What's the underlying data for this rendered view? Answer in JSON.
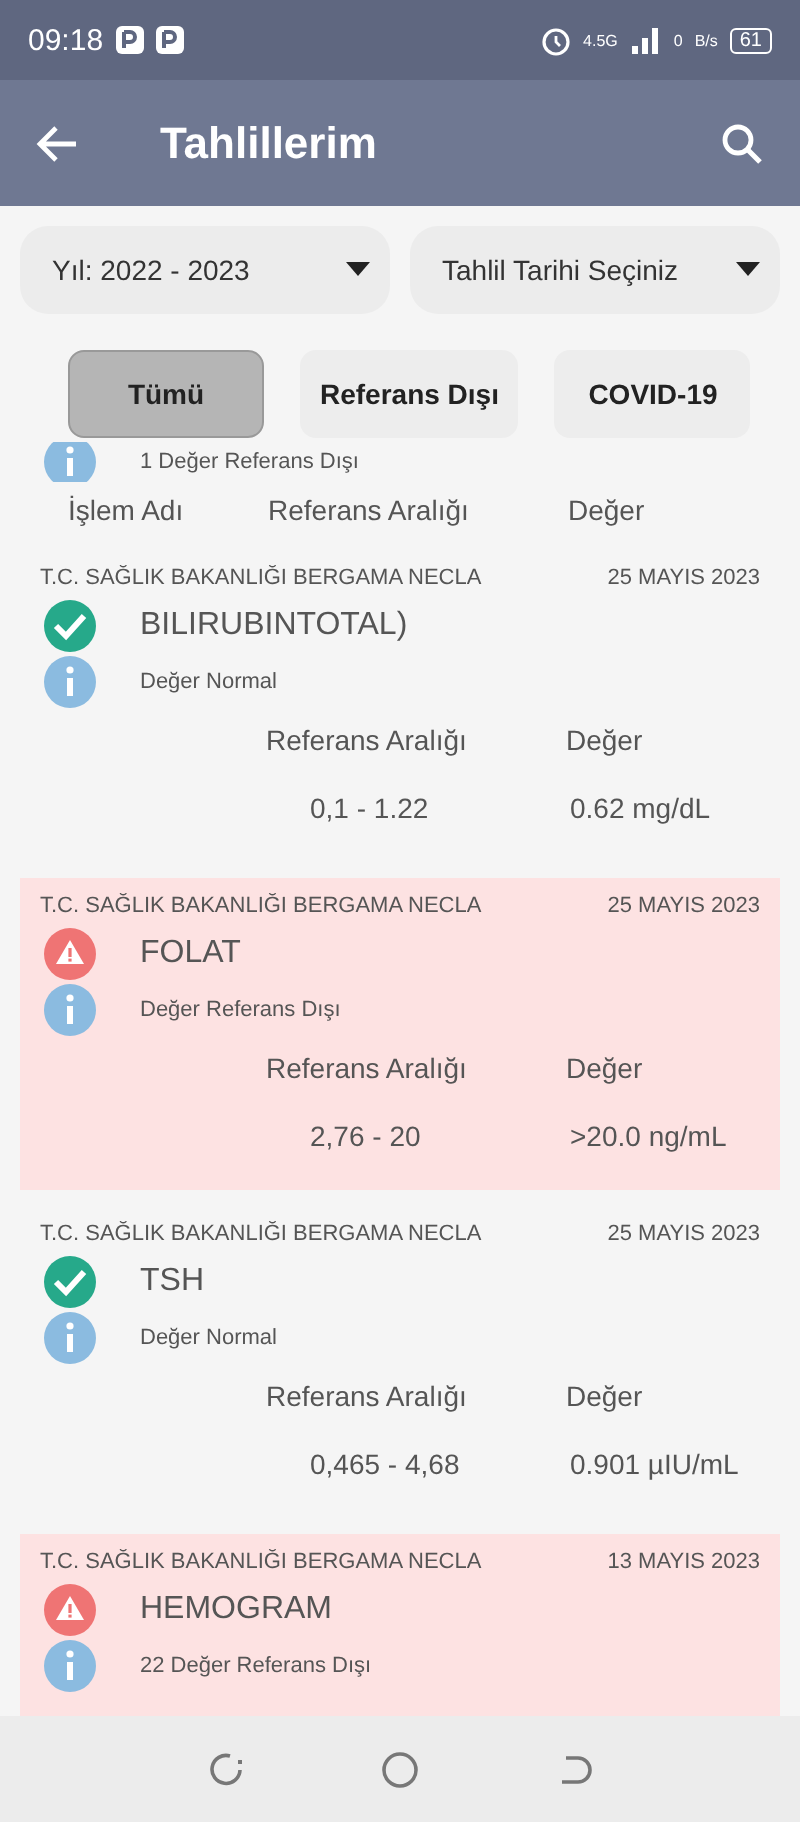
{
  "status_bar": {
    "time": "09:18",
    "battery": "61",
    "net_speed_value": "0",
    "net_speed_unit": "B/s",
    "network": "4.5G"
  },
  "app_bar": {
    "title": "Tahlillerim"
  },
  "filters": [
    {
      "label": "Yıl: 2022 - 2023"
    },
    {
      "label": "Tahlil Tarihi Seçiniz"
    }
  ],
  "tabs": [
    {
      "label": "Tümü",
      "selected": true
    },
    {
      "label": "Referans Dışı",
      "selected": false
    },
    {
      "label": "COVID-19",
      "selected": false
    }
  ],
  "partial_item": {
    "status_text": "1 Değer Referans Dışı"
  },
  "columns": [
    "İşlem Adı",
    "Referans Aralığı",
    "Değer"
  ],
  "results": [
    {
      "source": "T.C. SAĞLIK BAKANLIĞI BERGAMA NECLA",
      "date": "25 MAYIS 2023",
      "name": "BILIRUBINTOTAL)",
      "kind": "normal",
      "status_text": "Değer Normal",
      "range_label": "Referans Aralığı",
      "value_label": "Değer",
      "range": "0,1 - 1.22",
      "value": "0.62 mg/dL"
    },
    {
      "source": "T.C. SAĞLIK BAKANLIĞI BERGAMA NECLA",
      "date": "25 MAYIS 2023",
      "name": "FOLAT",
      "kind": "out",
      "status_text": "Değer Referans Dışı",
      "range_label": "Referans Aralığı",
      "value_label": "Değer",
      "range": "2,76 - 20",
      "value": ">20.0 ng/mL"
    },
    {
      "source": "T.C. SAĞLIK BAKANLIĞI BERGAMA NECLA",
      "date": "25 MAYIS 2023",
      "name": "TSH",
      "kind": "normal",
      "status_text": "Değer Normal",
      "range_label": "Referans Aralığı",
      "value_label": "Değer",
      "range": "0,465 - 4,68",
      "value": "0.901 µIU/mL"
    },
    {
      "source": "T.C. SAĞLIK BAKANLIĞI BERGAMA NECLA",
      "date": "13 MAYIS 2023",
      "name": "HEMOGRAM",
      "kind": "out",
      "status_text": "22 Değer Referans Dışı"
    }
  ]
}
